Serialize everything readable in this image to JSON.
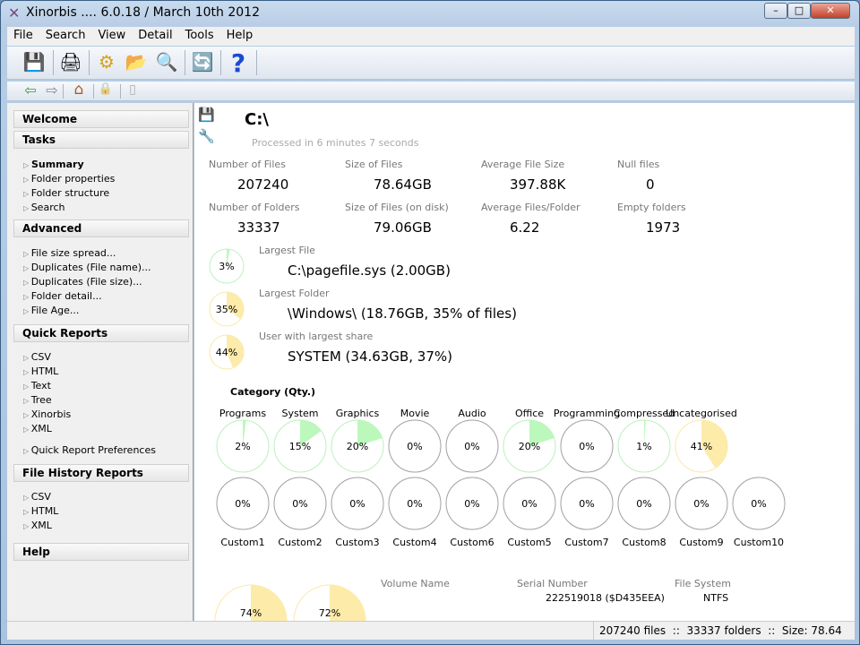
{
  "window": {
    "title": "Xinorbis .... 6.0.18 / March 10th 2012",
    "minimize": "–",
    "maximize": "□",
    "close": "✕"
  },
  "menu": [
    "File",
    "Search",
    "View",
    "Detail",
    "Tools",
    "Help"
  ],
  "toolbar": {
    "icons": [
      "save-icon",
      "print-icon",
      "plugin-icon",
      "open-folder-icon",
      "scan-icon",
      "refresh-icon",
      "help-icon"
    ],
    "glyphs": [
      "💾",
      "🖨",
      "⚙",
      "📂",
      "🔍",
      "🔄",
      "?"
    ]
  },
  "navbar": {
    "icons": [
      "back-icon",
      "forward-icon",
      "home-icon",
      "lock-icon",
      "database-icon"
    ],
    "glyphs": [
      "⇦",
      "⇨",
      "⌂",
      "🔒",
      "▯"
    ]
  },
  "sidebar": {
    "welcome": "Welcome",
    "tasks": "Tasks",
    "task_items": [
      "Summary",
      "Folder properties",
      "Folder structure",
      "Search"
    ],
    "advanced": "Advanced",
    "advanced_items": [
      "File size spread...",
      "Duplicates (File name)...",
      "Duplicates (File size)...",
      "Folder detail...",
      "File Age..."
    ],
    "quick_reports": "Quick Reports",
    "quick_items": [
      "CSV",
      "HTML",
      "Text",
      "Tree",
      "Xinorbis",
      "XML"
    ],
    "quick_prefs": "Quick Report Preferences",
    "history": "File History Reports",
    "history_items": [
      "CSV",
      "HTML",
      "XML"
    ],
    "help": "Help"
  },
  "summary": {
    "path": "C:\\",
    "processed": "Processed in 6 minutes 7 seconds",
    "stats": [
      {
        "label": "Number of Files",
        "value": "207240"
      },
      {
        "label": "Size of Files",
        "value": "78.64GB"
      },
      {
        "label": "Average File Size",
        "value": "397.88K"
      },
      {
        "label": "Null files",
        "value": "0"
      },
      {
        "label": "Number of Folders",
        "value": "33337"
      },
      {
        "label": "Size of Files (on disk)",
        "value": "79.06GB"
      },
      {
        "label": "Average Files/Folder",
        "value": "6.22"
      },
      {
        "label": "Empty folders",
        "value": "1973"
      }
    ],
    "largest": [
      {
        "label": "Largest File",
        "value": "C:\\pagefile.sys (2.00GB)",
        "percent": 3,
        "pct_label": "3%",
        "color": "green"
      },
      {
        "label": "Largest Folder",
        "value": "\\Windows\\ (18.76GB, 35% of files)",
        "percent": 35,
        "pct_label": "35%",
        "color": "yellow"
      },
      {
        "label": "User with largest share",
        "value": "SYSTEM (34.63GB, 37%)",
        "percent": 44,
        "pct_label": "44%",
        "color": "yellow"
      }
    ]
  },
  "category": {
    "title": "Category (Qty.)",
    "row1": [
      {
        "name": "Programs",
        "percent": 2,
        "label": "2%",
        "color": "green"
      },
      {
        "name": "System",
        "percent": 15,
        "label": "15%",
        "color": "green"
      },
      {
        "name": "Graphics",
        "percent": 20,
        "label": "20%",
        "color": "green"
      },
      {
        "name": "Movie",
        "percent": 0,
        "label": "0%",
        "color": "gray"
      },
      {
        "name": "Audio",
        "percent": 0,
        "label": "0%",
        "color": "gray"
      },
      {
        "name": "Office",
        "percent": 20,
        "label": "20%",
        "color": "green"
      },
      {
        "name": "Programming",
        "percent": 0,
        "label": "0%",
        "color": "gray"
      },
      {
        "name": "Compressed",
        "percent": 1,
        "label": "1%",
        "color": "green"
      },
      {
        "name": "Uncategorised",
        "percent": 41,
        "label": "41%",
        "color": "yellow"
      }
    ],
    "row2": [
      {
        "name": "Custom1",
        "percent": 0,
        "label": "0%"
      },
      {
        "name": "Custom2",
        "percent": 0,
        "label": "0%"
      },
      {
        "name": "Custom3",
        "percent": 0,
        "label": "0%"
      },
      {
        "name": "Custom4",
        "percent": 0,
        "label": "0%"
      },
      {
        "name": "Custom6",
        "percent": 0,
        "label": "0%"
      },
      {
        "name": "Custom5",
        "percent": 0,
        "label": "0%"
      },
      {
        "name": "Custom7",
        "percent": 0,
        "label": "0%"
      },
      {
        "name": "Custom8",
        "percent": 0,
        "label": "0%"
      },
      {
        "name": "Custom9",
        "percent": 0,
        "label": "0%"
      },
      {
        "name": "Custom10",
        "percent": 0,
        "label": "0%"
      }
    ]
  },
  "drive": {
    "pies": [
      {
        "percent": 74,
        "label": "74%"
      },
      {
        "percent": 72,
        "label": "72%"
      }
    ],
    "volume_name_label": "Volume Name",
    "volume_name": "",
    "serial_label": "Serial Number",
    "serial": "222519018 ($D435EEA)",
    "fs_label": "File System",
    "fs": "NTFS"
  },
  "status": "207240 files  ::  33337 folders  ::  Size: 78.64",
  "colors": {
    "green": "#bcf8bc",
    "green_border": "#bdf0bd",
    "yellow": "#fdebaa",
    "yellow_border": "#fbe8a8",
    "gray_border": "#a0a0a0"
  }
}
